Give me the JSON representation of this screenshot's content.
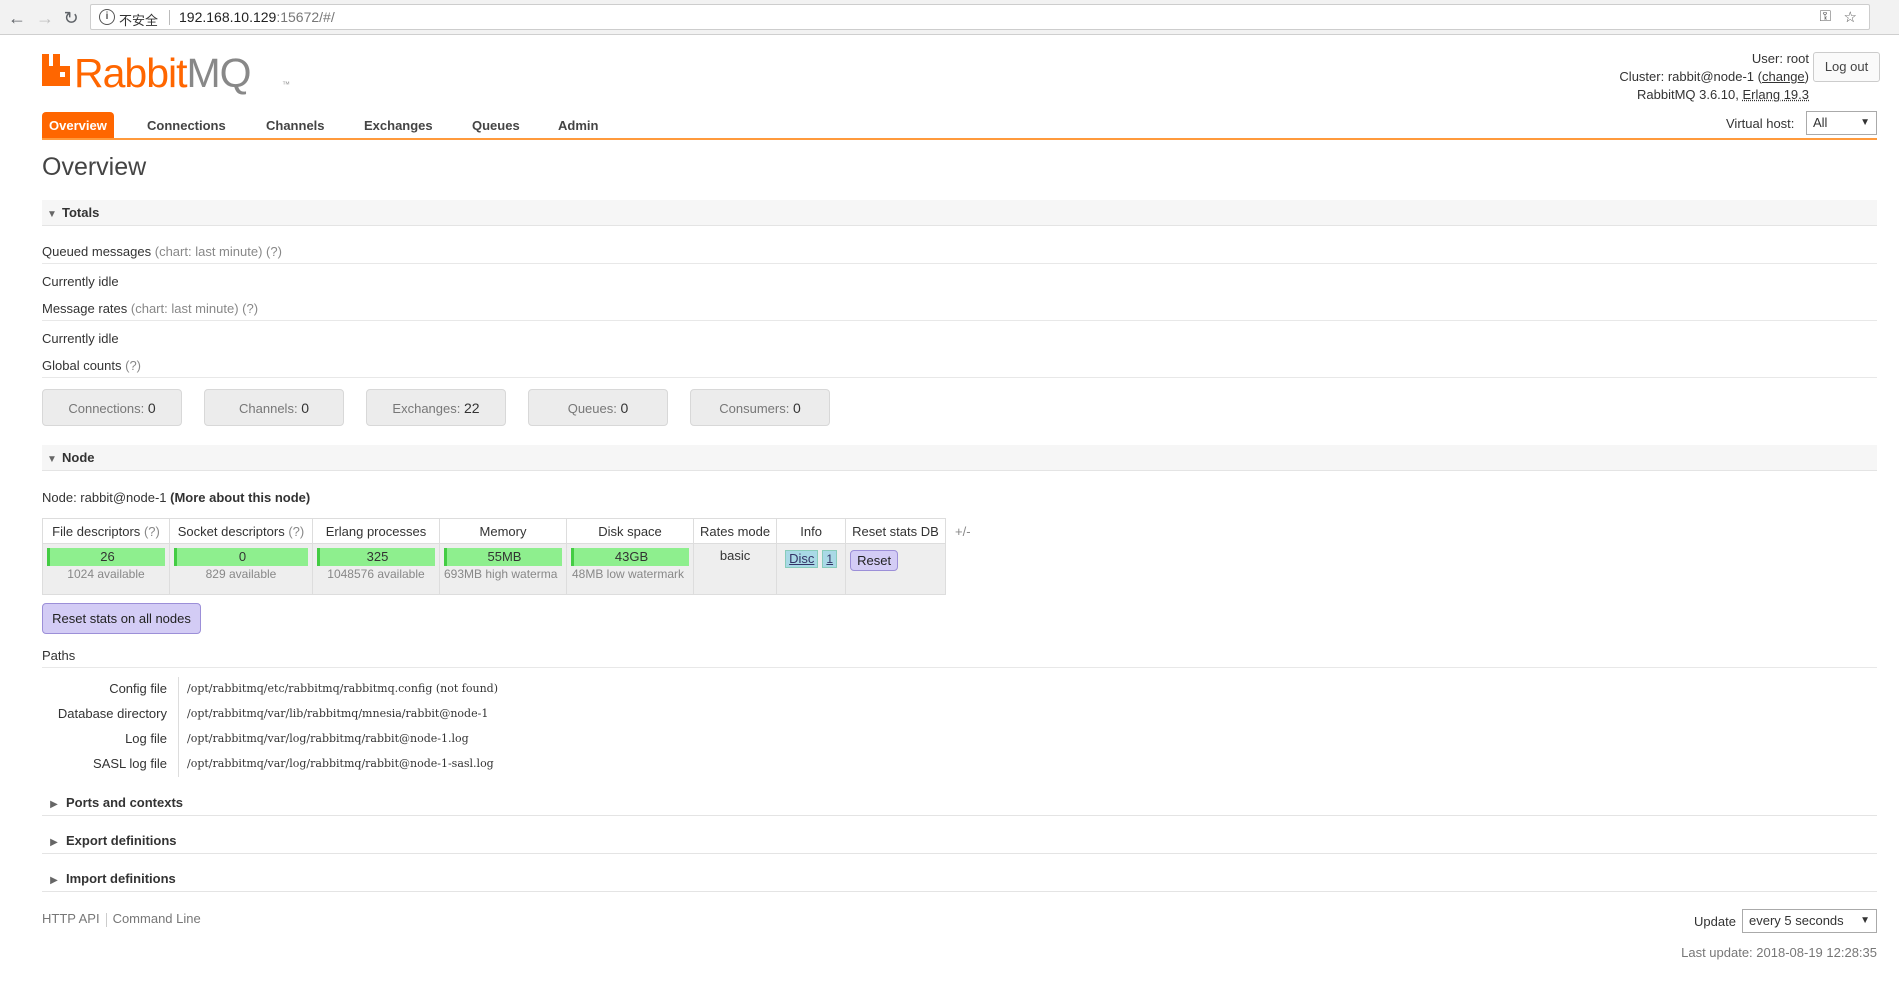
{
  "browser": {
    "insecure_label": "不安全",
    "url_host": "192.168.10.129",
    "url_rest": ":15672/#/"
  },
  "header": {
    "logo_brand_a": "Rabbit",
    "logo_brand_b": "MQ",
    "logo_tm": "™",
    "user_label": "User:",
    "user_value": "root",
    "cluster_label": "Cluster:",
    "cluster_value": "rabbit@node-1",
    "change_link": "change",
    "version_text": "RabbitMQ 3.6.10,",
    "erlang_text": "Erlang 19.3",
    "logout_label": "Log out",
    "virtual_host_label": "Virtual host:",
    "virtual_host_value": "All"
  },
  "tabs": [
    "Overview",
    "Connections",
    "Channels",
    "Exchanges",
    "Queues",
    "Admin"
  ],
  "page_title": "Overview",
  "totals": {
    "section_label": "Totals",
    "queued_label": "Queued messages",
    "queued_hint": "(chart: last minute) (?)",
    "queued_status": "Currently idle",
    "rates_label": "Message rates",
    "rates_hint": "(chart: last minute) (?)",
    "rates_status": "Currently idle",
    "global_label": "Global counts",
    "global_hint": "(?)",
    "counts": [
      {
        "label": "Connections:",
        "value": "0"
      },
      {
        "label": "Channels:",
        "value": "0"
      },
      {
        "label": "Exchanges:",
        "value": "22"
      },
      {
        "label": "Queues:",
        "value": "0"
      },
      {
        "label": "Consumers:",
        "value": "0"
      }
    ]
  },
  "node": {
    "section_label": "Node",
    "node_prefix": "Node: rabbit@node-1",
    "more_link": "(More about this node)",
    "headers": {
      "file": "File descriptors",
      "file_hint": "(?)",
      "socket": "Socket descriptors",
      "socket_hint": "(?)",
      "erlang": "Erlang processes",
      "memory": "Memory",
      "disk": "Disk space",
      "rates": "Rates mode",
      "info": "Info",
      "reset": "Reset stats DB"
    },
    "plus_minus": "+/-",
    "file_value": "26",
    "file_avail": "1024 available",
    "socket_value": "0",
    "socket_avail": "829 available",
    "erlang_value": "325",
    "erlang_avail": "1048576 available",
    "memory_value": "55MB",
    "memory_avail": "693MB high watermark",
    "disk_value": "43GB",
    "disk_avail": "48MB low watermark",
    "rates_value": "basic",
    "info_disc": "Disc",
    "info_one": "1",
    "reset_button": "Reset",
    "reset_all_button": "Reset stats on all nodes"
  },
  "paths": {
    "section_label": "Paths",
    "rows": [
      {
        "label": "Config file",
        "value": "/opt/rabbitmq/etc/rabbitmq/rabbitmq.config (not found)"
      },
      {
        "label": "Database directory",
        "value": "/opt/rabbitmq/var/lib/rabbitmq/mnesia/rabbit@node-1"
      },
      {
        "label": "Log file",
        "value": "/opt/rabbitmq/var/log/rabbitmq/rabbit@node-1.log"
      },
      {
        "label": "SASL log file",
        "value": "/opt/rabbitmq/var/log/rabbitmq/rabbit@node-1-sasl.log"
      }
    ]
  },
  "collapsed_sections": [
    "Ports and contexts",
    "Export definitions",
    "Import definitions"
  ],
  "footer": {
    "http_api": "HTTP API",
    "command_line": "Command Line",
    "update_label": "Update",
    "update_value": "every 5 seconds",
    "last_update": "Last update: 2018-08-19 12:28:35"
  },
  "colors": {
    "brand": "#ff6600",
    "bar_fill": "#8eef8e",
    "button_purple": "#d3ccf5"
  }
}
